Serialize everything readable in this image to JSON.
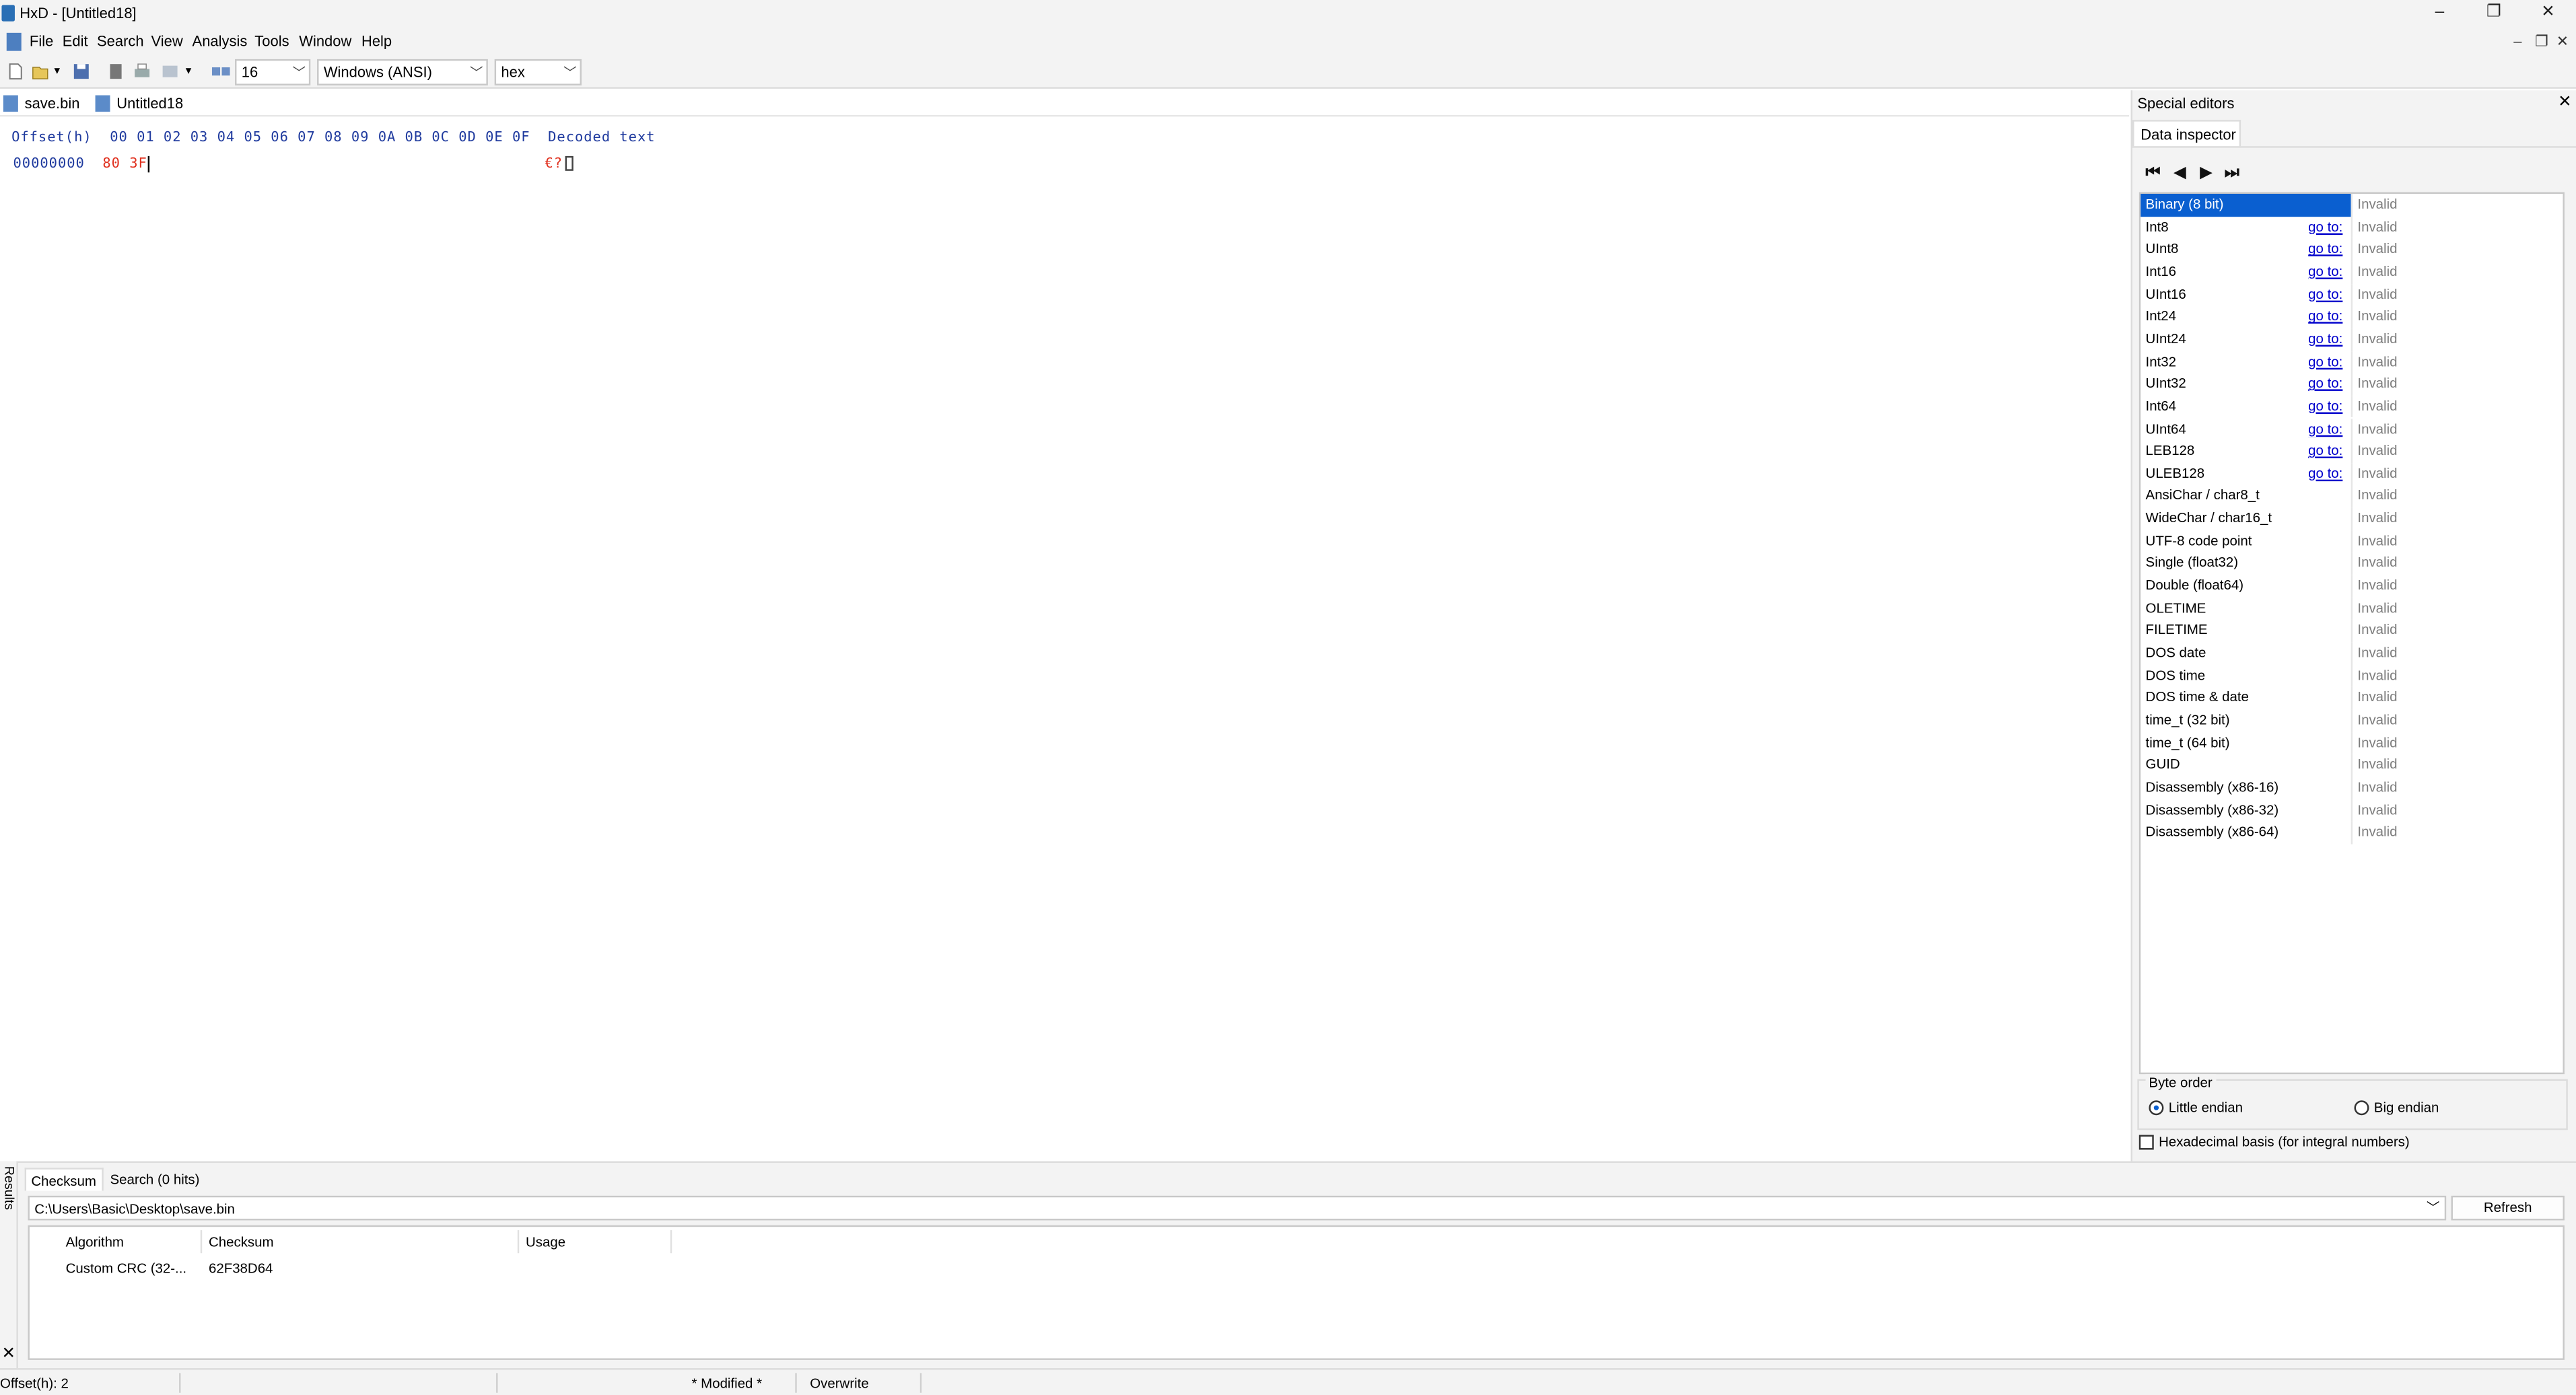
{
  "window": {
    "title": "HxD - [Untitled18]",
    "controls": {
      "minimize": "–",
      "restore": "❐",
      "close": "✕"
    }
  },
  "menu": [
    "File",
    "Edit",
    "Search",
    "View",
    "Analysis",
    "Tools",
    "Window",
    "Help"
  ],
  "toolbar": {
    "bytes_per_row": "16",
    "charset": "Windows (ANSI)",
    "offset_base": "hex"
  },
  "doc_tabs": [
    {
      "label": "save.bin",
      "active": false
    },
    {
      "label": "Untitled18",
      "active": true
    }
  ],
  "hex": {
    "header_offset": "Offset(h)",
    "header_columns": "00 01 02 03 04 05 06 07 08 09 0A 0B 0C 0D 0E 0F",
    "header_decoded": "Decoded text",
    "rows": [
      {
        "offset": "00000000",
        "bytes": "80 3F",
        "decoded": "€?"
      }
    ]
  },
  "special_editors": {
    "title": "Special editors",
    "close": "✕",
    "tab": "Data inspector",
    "nav": [
      "first",
      "previous",
      "next",
      "last"
    ],
    "rows": [
      {
        "name": "Binary (8 bit)",
        "goto": "",
        "value": "Invalid",
        "selected": true
      },
      {
        "name": "Int8",
        "goto": "go to:",
        "value": "Invalid"
      },
      {
        "name": "UInt8",
        "goto": "go to:",
        "value": "Invalid"
      },
      {
        "name": "Int16",
        "goto": "go to:",
        "value": "Invalid"
      },
      {
        "name": "UInt16",
        "goto": "go to:",
        "value": "Invalid"
      },
      {
        "name": "Int24",
        "goto": "go to:",
        "value": "Invalid"
      },
      {
        "name": "UInt24",
        "goto": "go to:",
        "value": "Invalid"
      },
      {
        "name": "Int32",
        "goto": "go to:",
        "value": "Invalid"
      },
      {
        "name": "UInt32",
        "goto": "go to:",
        "value": "Invalid"
      },
      {
        "name": "Int64",
        "goto": "go to:",
        "value": "Invalid"
      },
      {
        "name": "UInt64",
        "goto": "go to:",
        "value": "Invalid"
      },
      {
        "name": "LEB128",
        "goto": "go to:",
        "value": "Invalid"
      },
      {
        "name": "ULEB128",
        "goto": "go to:",
        "value": "Invalid"
      },
      {
        "name": "AnsiChar / char8_t",
        "goto": "",
        "value": "Invalid"
      },
      {
        "name": "WideChar / char16_t",
        "goto": "",
        "value": "Invalid"
      },
      {
        "name": "UTF-8 code point",
        "goto": "",
        "value": "Invalid"
      },
      {
        "name": "Single (float32)",
        "goto": "",
        "value": "Invalid"
      },
      {
        "name": "Double (float64)",
        "goto": "",
        "value": "Invalid"
      },
      {
        "name": "OLETIME",
        "goto": "",
        "value": "Invalid"
      },
      {
        "name": "FILETIME",
        "goto": "",
        "value": "Invalid"
      },
      {
        "name": "DOS date",
        "goto": "",
        "value": "Invalid"
      },
      {
        "name": "DOS time",
        "goto": "",
        "value": "Invalid"
      },
      {
        "name": "DOS time & date",
        "goto": "",
        "value": "Invalid"
      },
      {
        "name": "time_t (32 bit)",
        "goto": "",
        "value": "Invalid"
      },
      {
        "name": "time_t (64 bit)",
        "goto": "",
        "value": "Invalid"
      },
      {
        "name": "GUID",
        "goto": "",
        "value": "Invalid"
      },
      {
        "name": "Disassembly (x86-16)",
        "goto": "",
        "value": "Invalid"
      },
      {
        "name": "Disassembly (x86-32)",
        "goto": "",
        "value": "Invalid"
      },
      {
        "name": "Disassembly (x86-64)",
        "goto": "",
        "value": "Invalid"
      }
    ],
    "byte_order": {
      "legend": "Byte order",
      "little": "Little endian",
      "big": "Big endian",
      "selected": "little"
    },
    "hex_basis": {
      "label": "Hexadecimal basis (for integral numbers)",
      "checked": false
    }
  },
  "results": {
    "side_label": "Results",
    "close": "✕",
    "tabs": [
      "Checksum",
      "Search (0 hits)"
    ],
    "active_tab": 0,
    "file_path": "C:\\Users\\Basic\\Desktop\\save.bin",
    "refresh": "Refresh",
    "columns": [
      "Algorithm",
      "Checksum",
      "Usage"
    ],
    "rows": [
      {
        "algorithm": "Custom CRC (32-...",
        "checksum": "62F38D64",
        "usage": ""
      }
    ]
  },
  "status": {
    "offset": "Offset(h): 2",
    "modified": "* Modified *",
    "mode": "Overwrite"
  },
  "colors": {
    "accent": "#0a5fd0",
    "offset_blue": "#1f3a9e",
    "byte_red": "#e0301e",
    "link": "#0000cc",
    "invalid_gray": "#7d7d7d"
  }
}
